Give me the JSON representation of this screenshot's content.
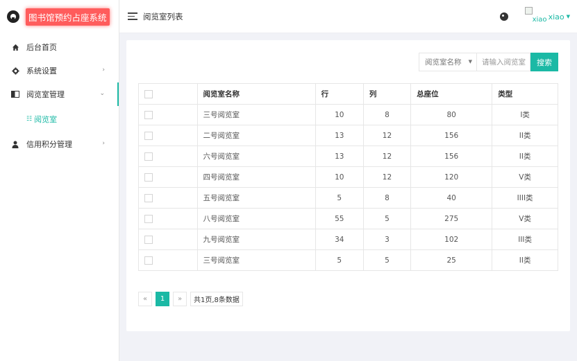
{
  "brand": {
    "title": "图书馆预约占座系统"
  },
  "header": {
    "page_title": "阅览室列表",
    "username": "xiao",
    "avatar_alt": "xiao"
  },
  "sidebar": {
    "items": [
      {
        "label": "后台首页",
        "icon": "home-icon"
      },
      {
        "label": "系统设置",
        "icon": "gear-icon"
      },
      {
        "label": "阅览室管理",
        "icon": "book-icon"
      },
      {
        "label": "阅览室",
        "icon": "grid-icon"
      },
      {
        "label": "信用积分管理",
        "icon": "user-icon"
      }
    ]
  },
  "search": {
    "field_label": "阅览室名称",
    "placeholder": "请输入阅览室",
    "button_label": "搜索"
  },
  "table": {
    "columns": [
      "阅览室名称",
      "行",
      "列",
      "总座位",
      "类型"
    ],
    "rows": [
      [
        "三号阅览室",
        "10",
        "8",
        "80",
        "I类"
      ],
      [
        "二号阅览室",
        "13",
        "12",
        "156",
        "II类"
      ],
      [
        "六号阅览室",
        "13",
        "12",
        "156",
        "II类"
      ],
      [
        "四号阅览室",
        "10",
        "12",
        "120",
        "V类"
      ],
      [
        "五号阅览室",
        "5",
        "8",
        "40",
        "IIII类"
      ],
      [
        "八号阅览室",
        "55",
        "5",
        "275",
        "V类"
      ],
      [
        "九号阅览室",
        "34",
        "3",
        "102",
        "III类"
      ],
      [
        "三号阅览室",
        "5",
        "5",
        "25",
        "II类"
      ]
    ]
  },
  "pagination": {
    "prev": "«",
    "current": "1",
    "next": "»",
    "info": "共1页,8条数据"
  },
  "colors": {
    "accent": "#1bb9a5",
    "brand_bg": "#ff5c5c"
  }
}
